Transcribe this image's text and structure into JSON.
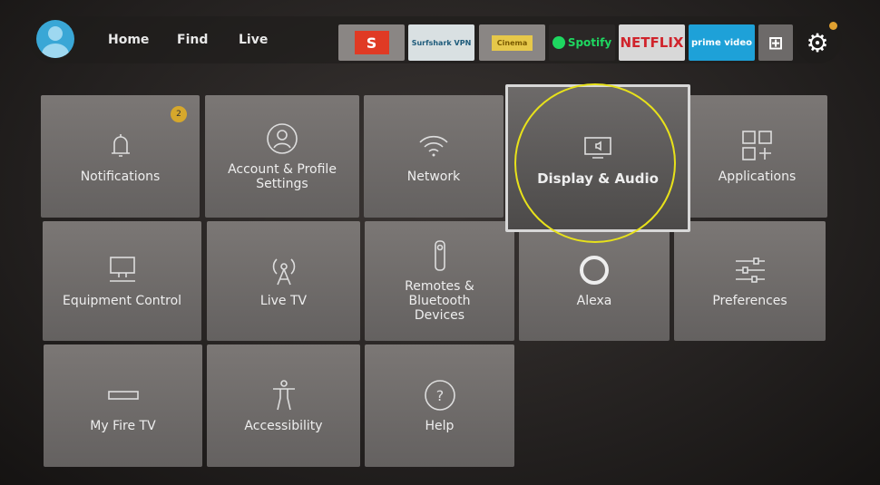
{
  "nav": {
    "links": [
      "Home",
      "Find",
      "Live"
    ],
    "apps": [
      {
        "name": "S",
        "color": "#e03a24"
      },
      {
        "name": "Surfshark VPN",
        "color": "#d9e0e2"
      },
      {
        "name": "Cinema",
        "color": "#b8b4b0"
      },
      {
        "name": "Spotify",
        "color": "#2a2726"
      },
      {
        "name": "NETFLIX",
        "color": "#d8d8d8"
      },
      {
        "name": "prime video",
        "color": "#1ea1d8"
      }
    ]
  },
  "tiles": [
    {
      "label": "Notifications",
      "icon": "bell-icon",
      "badge": "2"
    },
    {
      "label": "Account & Profile Settings",
      "icon": "user-icon"
    },
    {
      "label": "Network",
      "icon": "wifi-icon"
    },
    {
      "label": "Display & Audio",
      "icon": "display-icon",
      "focused": true
    },
    {
      "label": "Applications",
      "icon": "apps-icon"
    },
    {
      "label": "Equipment Control",
      "icon": "monitor-icon"
    },
    {
      "label": "Live TV",
      "icon": "antenna-icon"
    },
    {
      "label": "Remotes & Bluetooth Devices",
      "icon": "remote-icon"
    },
    {
      "label": "Alexa",
      "icon": "alexa-icon"
    },
    {
      "label": "Preferences",
      "icon": "sliders-icon"
    },
    {
      "label": "My Fire TV",
      "icon": "firetv-icon"
    },
    {
      "label": "Accessibility",
      "icon": "accessibility-icon"
    },
    {
      "label": "Help",
      "icon": "help-icon"
    }
  ]
}
